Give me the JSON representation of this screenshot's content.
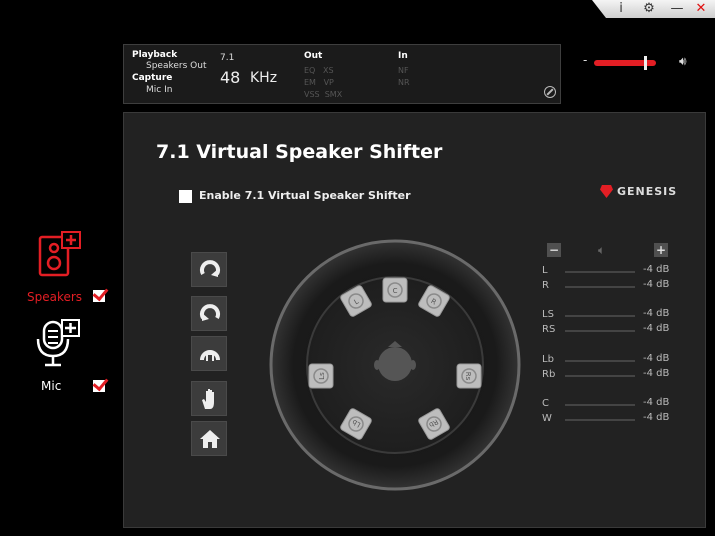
{
  "window": {
    "info_icon": "i",
    "settings_icon": "gear-icon",
    "minimize_icon": "—",
    "close_icon": "✕"
  },
  "info": {
    "playback_label": "Playback",
    "playback_device": "Speakers Out",
    "capture_label": "Capture",
    "capture_device": "Mic In",
    "channels": "7.1",
    "sample_rate": "48",
    "sample_unit": "KHz",
    "out_label": "Out",
    "out_row1": "EQ   XS",
    "out_row2": "EM   VP",
    "out_row3": "VSS  SMX",
    "in_label": "In",
    "in_row1": "NF",
    "in_row2": "NR"
  },
  "volume": {
    "level": 0.85,
    "minus": "-"
  },
  "sidebar": {
    "speakers_label": "Speakers",
    "mic_label": "Mic",
    "speakers_checked": true,
    "mic_checked": true
  },
  "panel": {
    "title": "7.1 Virtual Speaker Shifter",
    "enable_label": "Enable 7.1 Virtual Speaker Shifter",
    "brand": "GENESIS"
  },
  "levels": {
    "minus": "−",
    "plus": "+",
    "rows": [
      {
        "ch": "L",
        "db": "-4 dB"
      },
      {
        "ch": "R",
        "db": "-4 dB"
      },
      {
        "ch": "LS",
        "db": "-4 dB"
      },
      {
        "ch": "RS",
        "db": "-4 dB"
      },
      {
        "ch": "Lb",
        "db": "-4 dB"
      },
      {
        "ch": "Rb",
        "db": "-4 dB"
      },
      {
        "ch": "C",
        "db": "-4 dB"
      },
      {
        "ch": "W",
        "db": "-4 dB"
      }
    ]
  },
  "speakers": [
    "C",
    "L",
    "R",
    "Ls",
    "Rs",
    "Lb",
    "Rb"
  ]
}
